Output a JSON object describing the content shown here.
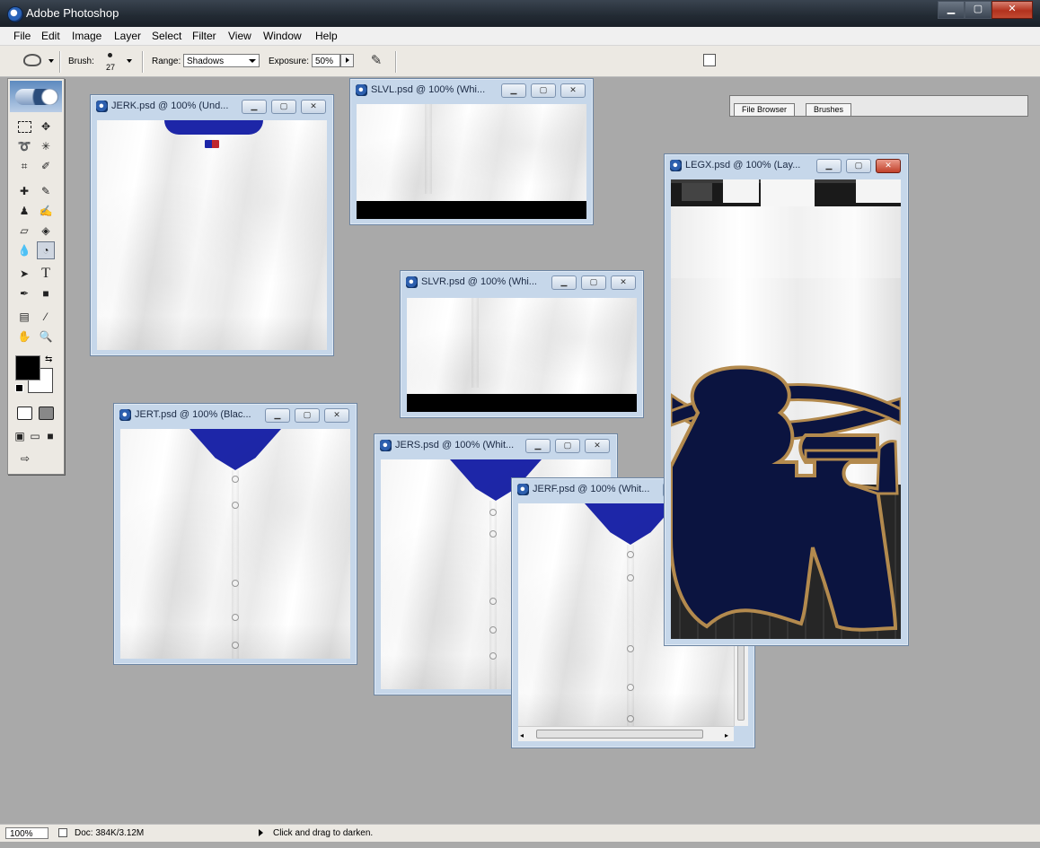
{
  "app": {
    "title": "Adobe Photoshop"
  },
  "window_controls": {
    "minimize": "▁",
    "maximize": "▢",
    "close": "✕"
  },
  "menu": [
    "File",
    "Edit",
    "Image",
    "Layer",
    "Select",
    "Filter",
    "View",
    "Window",
    "Help"
  ],
  "options": {
    "brush_label": "Brush:",
    "brush_size": "27",
    "range_label": "Range:",
    "range_value": "Shadows",
    "exposure_label": "Exposure:",
    "exposure_value": "50%"
  },
  "palette_well": {
    "tabs": [
      "File Browser",
      "Brushes"
    ]
  },
  "documents": [
    {
      "title": "JERK.psd @ 100% (Und..."
    },
    {
      "title": "SLVL.psd @ 100% (Whi..."
    },
    {
      "title": "SLVR.psd @ 100% (Whi..."
    },
    {
      "title": "JERT.psd @ 100% (Blac..."
    },
    {
      "title": "JERS.psd @ 100% (Whit..."
    },
    {
      "title": "JERF.psd @ 100% (Whit..."
    },
    {
      "title": "LEGX.psd @ 100% (Lay..."
    }
  ],
  "status": {
    "zoom": "100%",
    "doc": "Doc: 384K/3.12M",
    "hint": "Click and drag to darken."
  },
  "colors": {
    "collar_blue": "#1d26a8",
    "navy": "#0b1440",
    "gold": "#b38a4e"
  }
}
